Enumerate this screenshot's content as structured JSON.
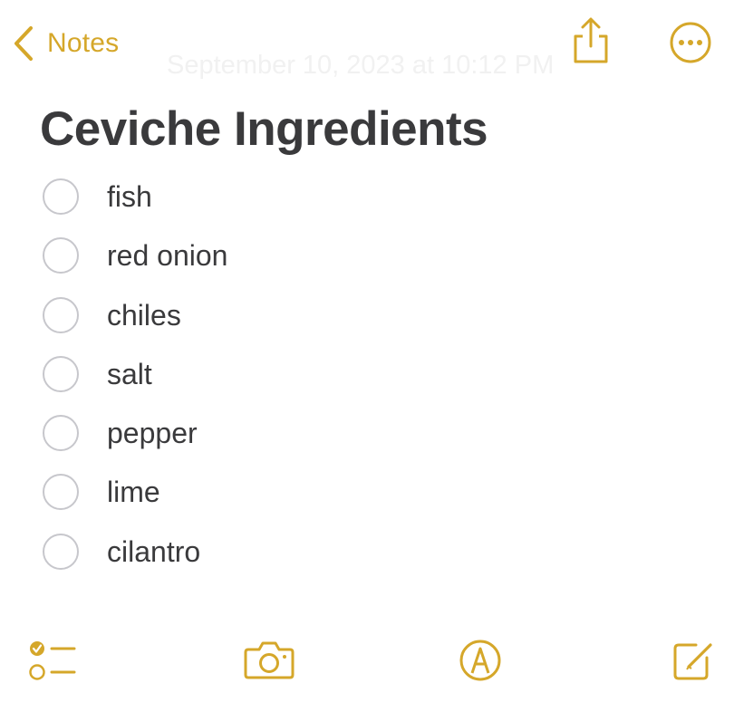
{
  "nav": {
    "back_label": "Notes",
    "timestamp": "September 10, 2023 at 10:12 PM",
    "share_icon": "share-icon",
    "more_icon": "more-icon"
  },
  "note": {
    "title": "Ceviche Ingredients",
    "items": [
      {
        "text": "fish",
        "checked": false
      },
      {
        "text": "red onion",
        "checked": false
      },
      {
        "text": "chiles",
        "checked": false
      },
      {
        "text": "salt",
        "checked": false
      },
      {
        "text": "pepper",
        "checked": false
      },
      {
        "text": "lime",
        "checked": false
      },
      {
        "text": "cilantro",
        "checked": false
      }
    ]
  },
  "toolbar": {
    "icons": [
      "checklist-icon",
      "camera-icon",
      "markup-icon",
      "compose-icon"
    ]
  },
  "colors": {
    "accent": "#d5a72a",
    "text": "#3a3a3c",
    "circle_border": "#c7c7cc",
    "background": "#ffffff"
  }
}
